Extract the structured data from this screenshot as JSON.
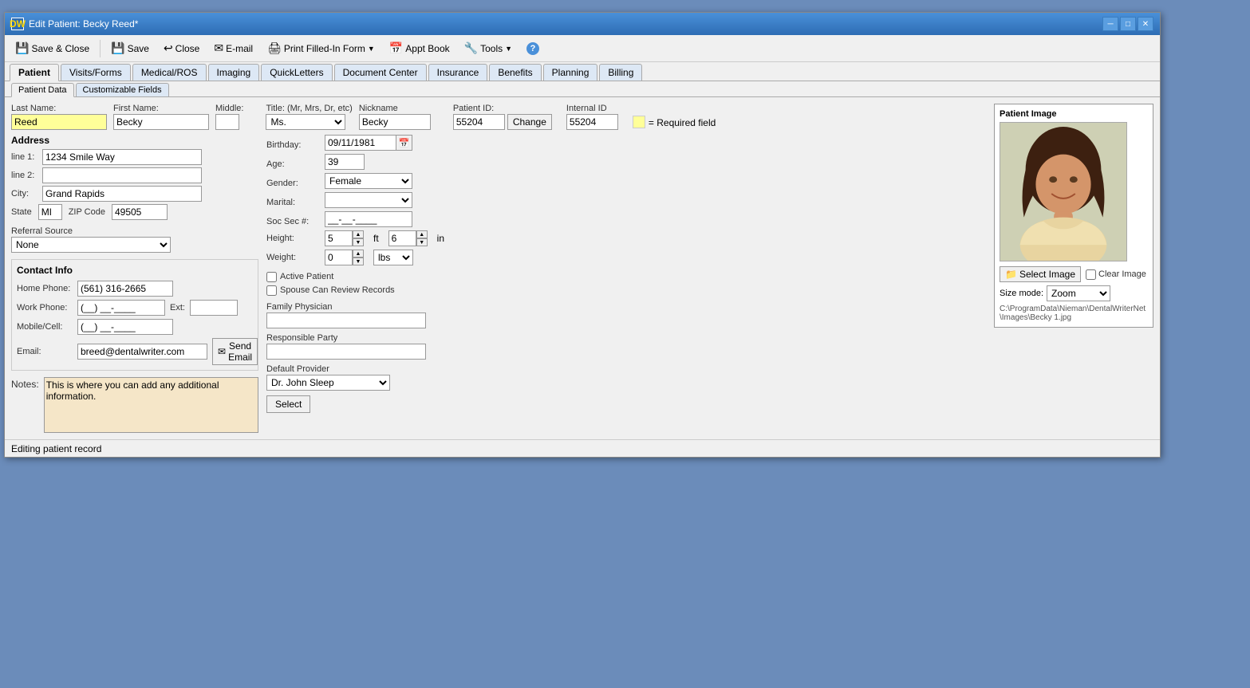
{
  "window": {
    "title": "Edit Patient: Becky Reed*",
    "icon": "DW"
  },
  "toolbar": {
    "save_close": "Save & Close",
    "save": "Save",
    "close": "Close",
    "email": "E-mail",
    "print": "Print Filled-In Form",
    "appt_book": "Appt Book",
    "tools": "Tools",
    "help": "?"
  },
  "main_tabs": [
    "Patient",
    "Visits/Forms",
    "Medical/ROS",
    "Imaging",
    "QuickLetters",
    "Document Center",
    "Insurance",
    "Benefits",
    "Planning",
    "Billing"
  ],
  "sub_tabs": [
    "Patient Data",
    "Customizable Fields"
  ],
  "form": {
    "last_name_label": "Last Name:",
    "first_name_label": "First Name:",
    "middle_label": "Middle:",
    "title_label": "Title: (Mr, Mrs, Dr, etc)",
    "nickname_label": "Nickname",
    "patient_id_label": "Patient ID:",
    "internal_id_label": "Internal ID",
    "last_name": "Reed",
    "first_name": "Becky",
    "middle": "",
    "title_value": "Ms.",
    "nickname": "Becky",
    "patient_id": "55204",
    "internal_id": "55204",
    "change_btn": "Change",
    "required_field": "= Required field",
    "birthday_label": "Birthday:",
    "birthday": "09/11/1981",
    "age_label": "Age:",
    "age": "39",
    "gender_label": "Gender:",
    "gender": "Female",
    "marital_label": "Marital:",
    "marital": "",
    "soc_sec_label": "Soc Sec #:",
    "soc_sec": "__-__-____",
    "height_label": "Height:",
    "height_ft": "5",
    "height_in": "6",
    "height_ft_label": "ft",
    "height_in_label": "in",
    "weight_label": "Weight:",
    "weight": "0",
    "active_patient": "Active Patient",
    "spouse_review": "Spouse Can Review Records",
    "family_physician_label": "Family Physician",
    "family_physician": "",
    "responsible_party_label": "Responsible Party",
    "responsible_party": "",
    "default_provider_label": "Default Provider",
    "default_provider": "Dr. John Sleep",
    "address_label": "Address",
    "line1_label": "line 1:",
    "line1": "1234 Smile Way",
    "line2_label": "line 2:",
    "line2": "",
    "city_label": "City:",
    "city": "Grand Rapids",
    "state_label": "State",
    "state": "MI",
    "zip_label": "ZIP Code",
    "zip": "49505",
    "referral_label": "Referral Source",
    "referral": "None",
    "contact_label": "Contact Info",
    "home_phone_label": "Home Phone:",
    "home_phone": "(561) 316-2665",
    "work_phone_label": "Work Phone:",
    "work_phone": "(__) __-____",
    "ext_label": "Ext:",
    "ext": "",
    "mobile_label": "Mobile/Cell:",
    "mobile": "(__) __-____",
    "email_label": "Email:",
    "email": "breed@dentalwriter.com",
    "send_email": "Send Email",
    "notes_label": "Notes:",
    "notes_placeholder": "This is where you can add any additional information.",
    "select_btn": "Select"
  },
  "patient_image": {
    "title": "Patient Image",
    "select_image": "Select Image",
    "clear_image": "Clear Image",
    "size_mode_label": "Size mode:",
    "size_mode": "Zoom",
    "image_path": "C:\\ProgramData\\Nieman\\DentalWriterNet\\Images\\Becky 1.jpg"
  },
  "status_bar": {
    "text": "Editing patient record"
  }
}
